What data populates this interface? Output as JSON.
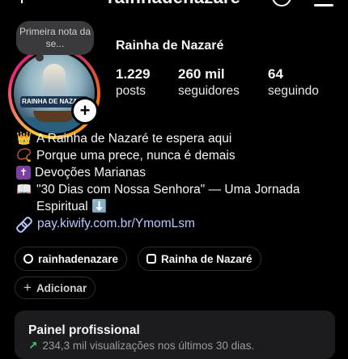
{
  "header": {
    "username": "rainhadenazare",
    "threads_icon": "threads-icon",
    "menu_icon": "hamburger-menu-icon"
  },
  "profile": {
    "note": "Primeira nota da se...",
    "display_name": "Rainha de Nazaré",
    "avatar_text": "RAINHA DE NAZARÉ",
    "add_icon": "plus-icon"
  },
  "stats": [
    {
      "value": "1.229",
      "label": "posts"
    },
    {
      "value": "260 mil",
      "label": "seguidores"
    },
    {
      "value": "64",
      "label": "seguindo"
    }
  ],
  "bio": [
    {
      "icon": "👑",
      "text": "A Rainha de Nazaré te espera aqui"
    },
    {
      "icon": "📿",
      "text": "Porque uma prece, nunca é demais"
    },
    {
      "icon": "✝",
      "text": "Devoções Marianas"
    },
    {
      "icon": "📖",
      "text": "\"30 Dias com Nossa Senhora\" — Uma Jornada Espiritual ⬇️"
    }
  ],
  "link": {
    "text": "pay.kiwify.com.br/YmomLsm",
    "icon": "link-icon"
  },
  "chips": {
    "threads": "rainhadenazare",
    "chat": "Rainha de Nazaré",
    "add": "Adicionar"
  },
  "panel": {
    "title": "Painel profissional",
    "subtitle": "234,3 mil visualizações nos últimos 30 dias.",
    "trend_color": "#3ccf6e"
  },
  "colors": {
    "background": "#000000",
    "link": "#b9c6ff",
    "panel": "#1c1c1e"
  }
}
